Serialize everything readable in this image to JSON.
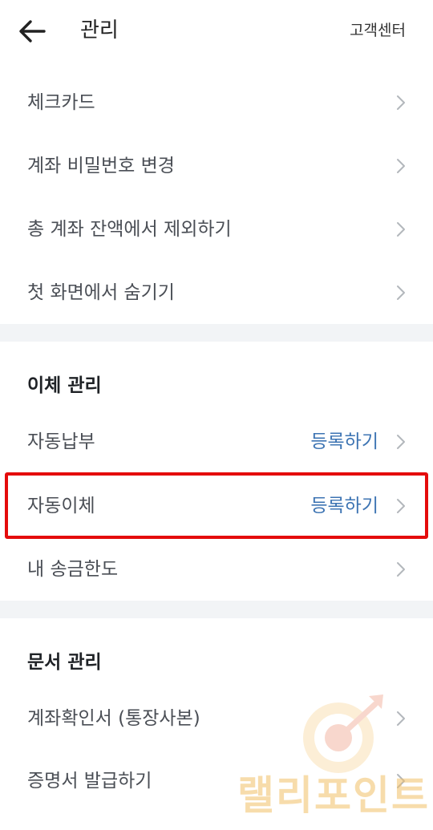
{
  "header": {
    "title": "관리",
    "help": "고객센터"
  },
  "menu": [
    {
      "label": "체크카드"
    },
    {
      "label": "계좌 비밀번호 변경"
    },
    {
      "label": "총 계좌 잔액에서 제외하기"
    },
    {
      "label": "첫 화면에서 숨기기"
    }
  ],
  "transfer_section": {
    "title": "이체 관리",
    "items": [
      {
        "label": "자동납부",
        "action": "등록하기"
      },
      {
        "label": "자동이체",
        "action": "등록하기"
      },
      {
        "label": "내 송금한도"
      }
    ]
  },
  "document_section": {
    "title": "문서 관리",
    "items": [
      {
        "label": "계좌확인서 (통장사본)"
      },
      {
        "label": "증명서 발급하기"
      }
    ]
  },
  "watermark": {
    "text": "랠리포인트"
  },
  "colors": {
    "action": "#3d74b3",
    "highlight": "#e40c0c",
    "divider": "#f2f4f6"
  }
}
